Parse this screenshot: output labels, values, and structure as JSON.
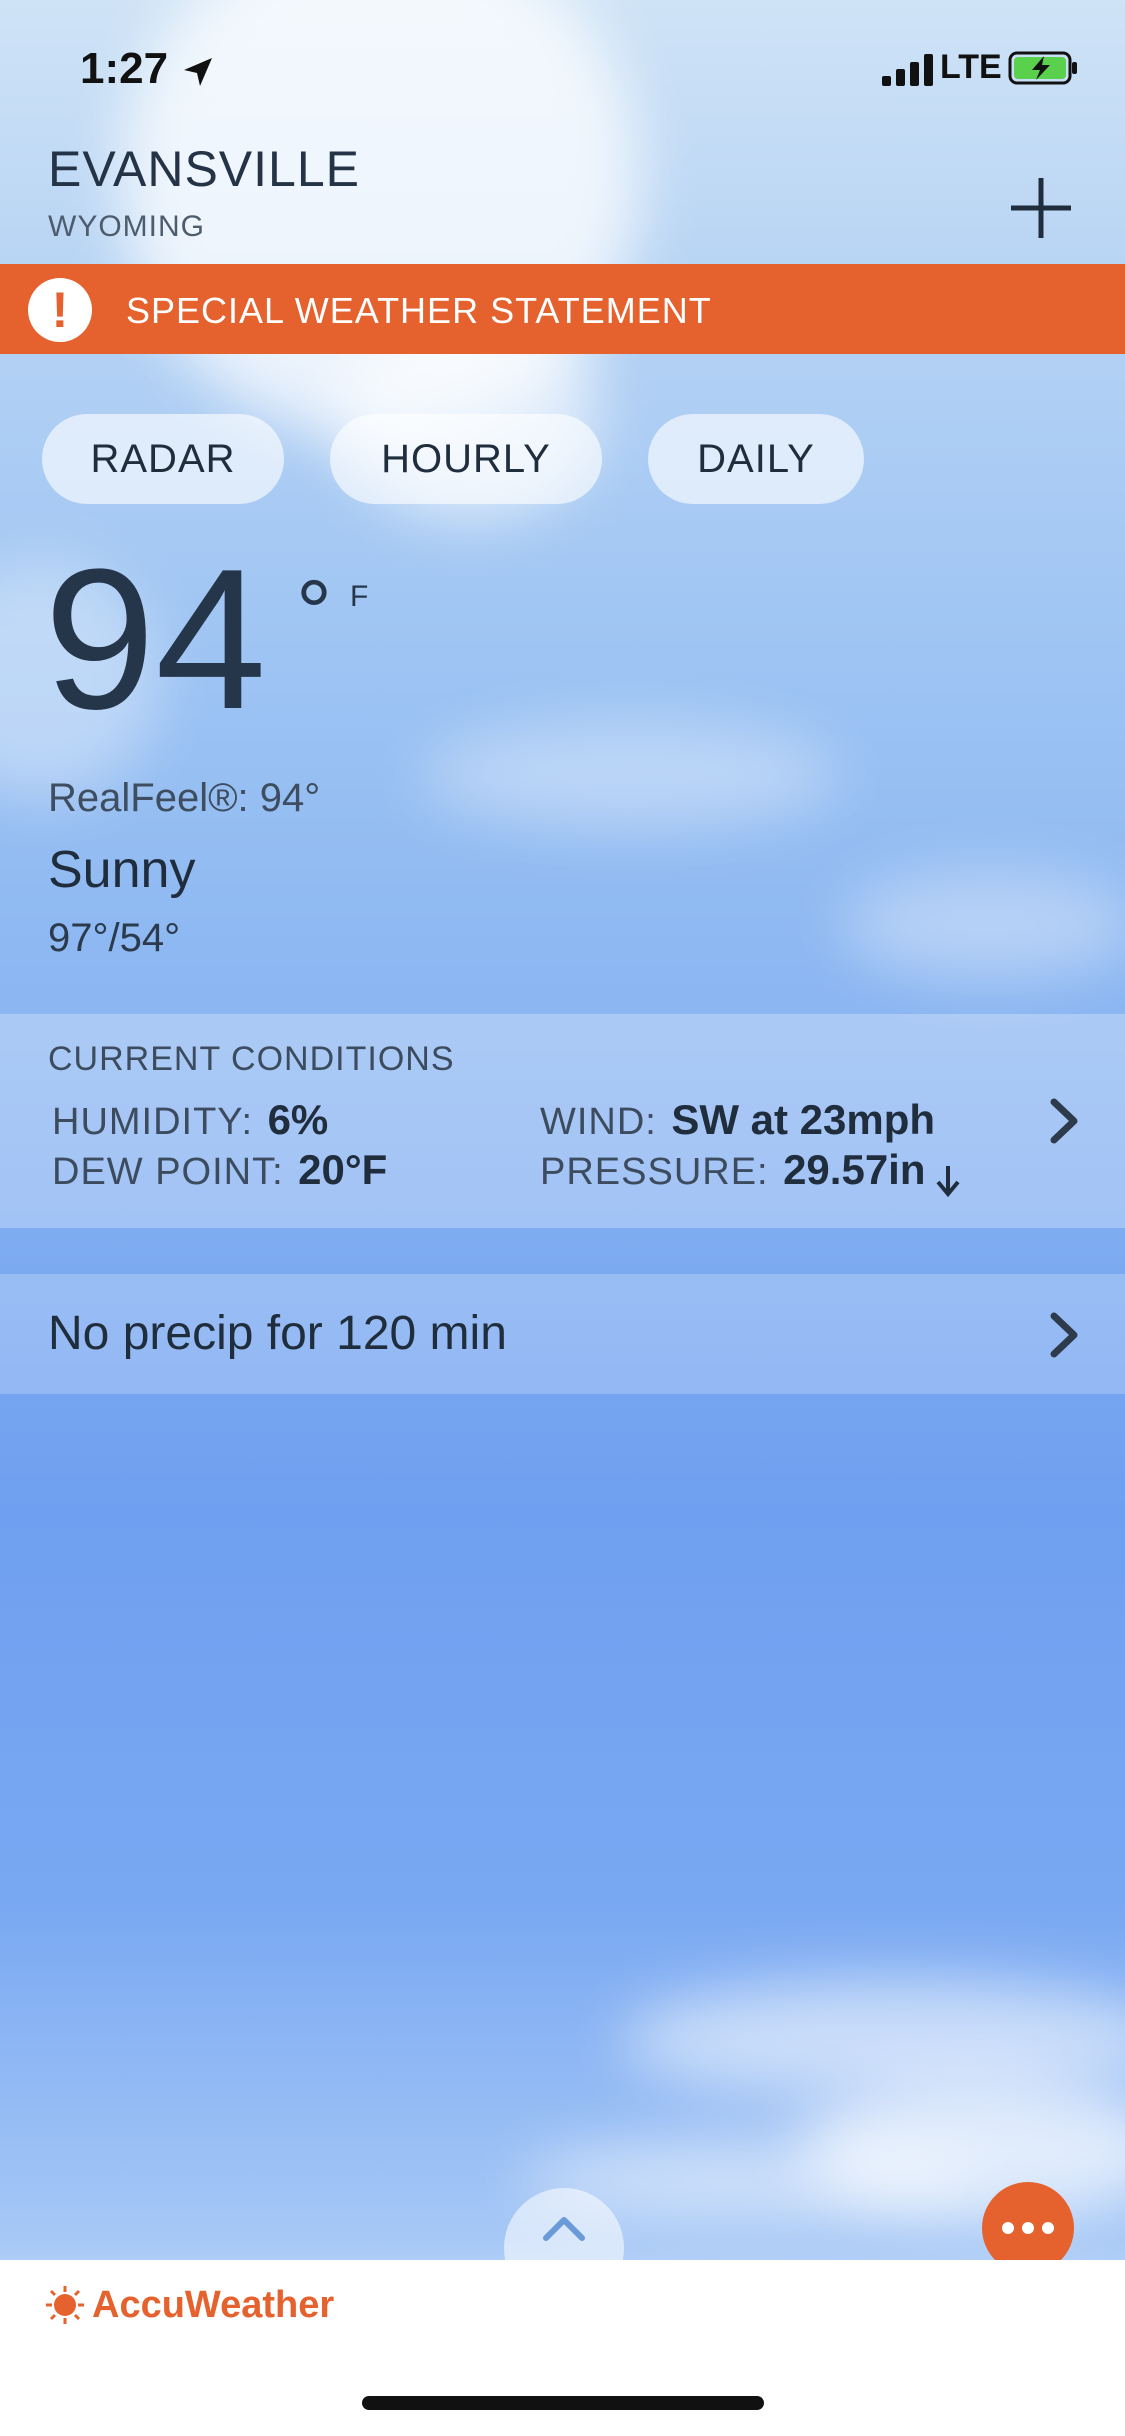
{
  "status_bar": {
    "time": "1:27",
    "network": "LTE"
  },
  "location": {
    "city": "EVANSVILLE",
    "state": "WYOMING"
  },
  "alert": {
    "text": "SPECIAL WEATHER STATEMENT",
    "icon_symbol": "!"
  },
  "tabs": [
    {
      "label": "RADAR"
    },
    {
      "label": "HOURLY"
    },
    {
      "label": "DAILY"
    }
  ],
  "current": {
    "temperature": "94",
    "degree_symbol": "°",
    "unit": "F",
    "realfeel": "RealFeel®: 94°",
    "phrase": "Sunny",
    "hi_lo": "97°/54°"
  },
  "conditions": {
    "title": "CURRENT CONDITIONS",
    "humidity_label": "HUMIDITY:",
    "humidity_value": "6%",
    "dew_point_label": "DEW POINT:",
    "dew_point_value": "20°F",
    "wind_label": "WIND:",
    "wind_value": "SW at 23mph",
    "pressure_label": "PRESSURE:",
    "pressure_value": "29.57in",
    "pressure_trend_icon": "down-arrow"
  },
  "precip": {
    "text": "No precip for 120 min"
  },
  "brand": {
    "name": "AccuWeather"
  },
  "colors": {
    "accent": "#e5612d",
    "text_dark": "#1f2d3d"
  }
}
